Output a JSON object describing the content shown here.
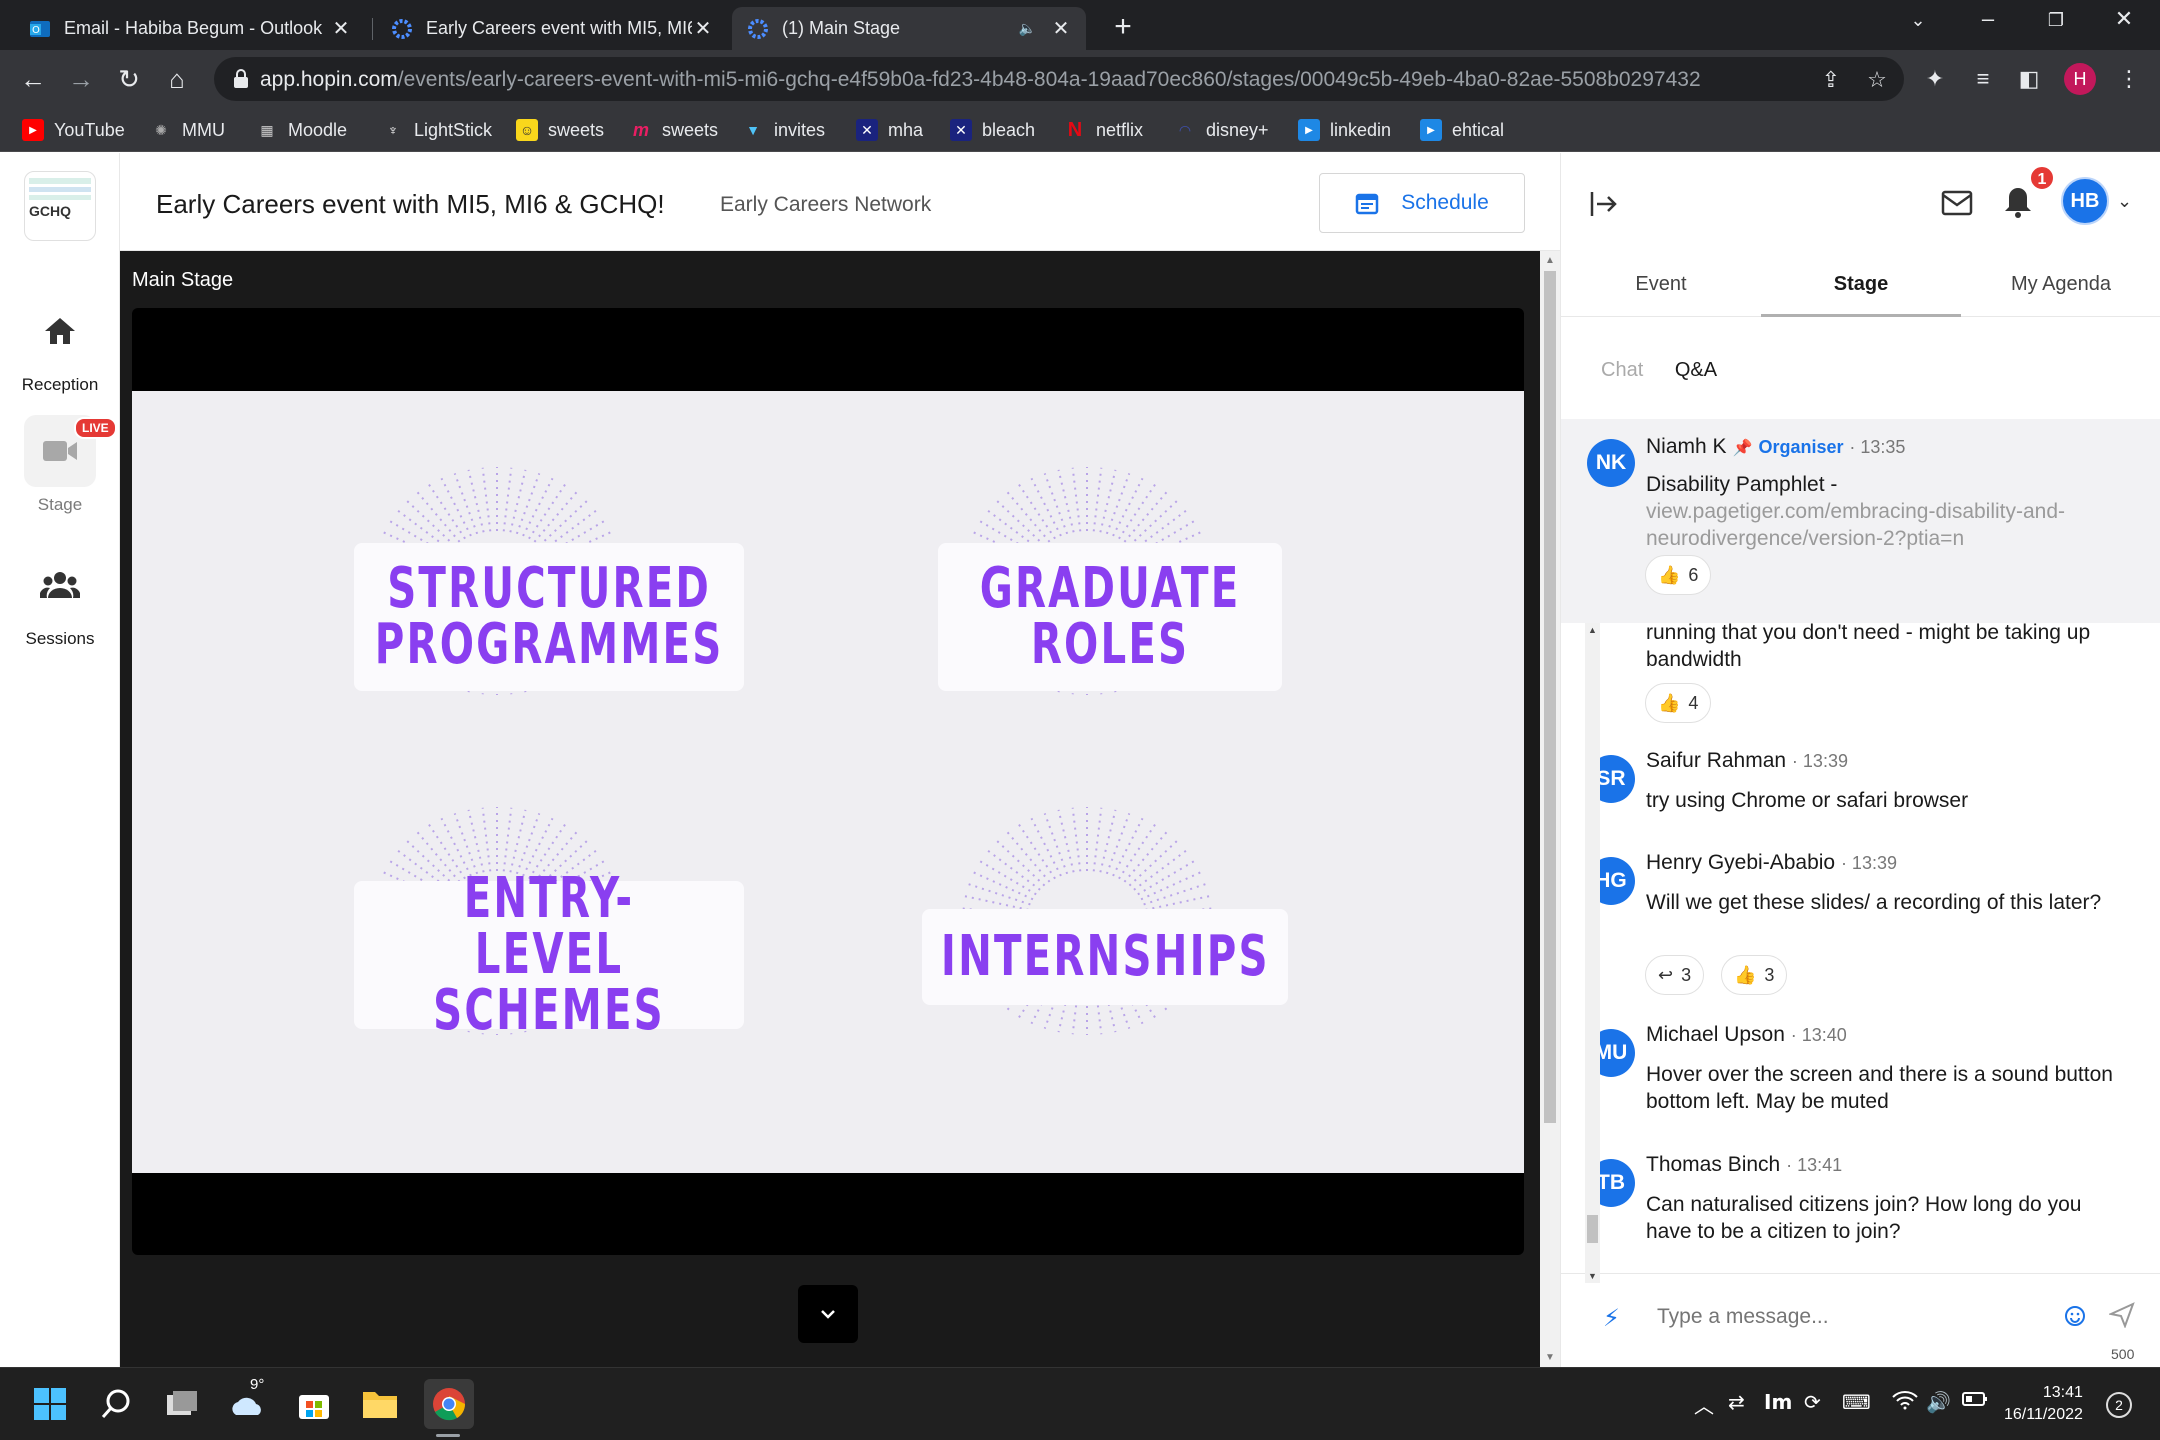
{
  "browser": {
    "tabs": [
      {
        "title": "Email - Habiba Begum - Outlook",
        "icon": "outlook-icon"
      },
      {
        "title": "Early Careers event with MI5, MI6",
        "icon": "hopin-icon"
      },
      {
        "title": "(1) Main Stage",
        "icon": "hopin-icon",
        "audio": true
      }
    ],
    "url_host": "app.hopin.com",
    "url_path": "/events/early-careers-event-with-mi5-mi6-gchq-e4f59b0a-fd23-4b48-804a-19aad70ec860/stages/00049c5b-49eb-4ba0-82ae-5508b0297432",
    "profile_initial": "H",
    "bookmarks": [
      "YouTube",
      "MMU",
      "Moodle",
      "LightStick",
      "sweets",
      "sweets",
      "invites",
      "mha",
      "bleach",
      "netflix",
      "disney+",
      "linkedin",
      "ehtical"
    ]
  },
  "leftnav": {
    "logo_text": "GCHQ",
    "items": [
      {
        "label": "Reception",
        "icon": "home-icon"
      },
      {
        "label": "Stage",
        "icon": "video-camera-icon",
        "badge": "LIVE"
      },
      {
        "label": "Sessions",
        "icon": "people-icon"
      }
    ]
  },
  "header": {
    "title": "Early Careers event with MI5, MI6 & GCHQ!",
    "organizer": "Early Careers Network",
    "schedule_label": "Schedule"
  },
  "stage": {
    "label": "Main Stage",
    "slide": {
      "cards": [
        {
          "line1": "STRUCTURED",
          "line2": "PROGRAMMES"
        },
        {
          "line1": "GRADUATE",
          "line2": "ROLES"
        },
        {
          "line1": "ENTRY-LEVEL",
          "line2": "SCHEMES"
        },
        {
          "line1": "INTERNSHIPS",
          "line2": ""
        }
      ]
    }
  },
  "panel": {
    "notification_count": "1",
    "user_initials": "HB",
    "tabs": [
      "Event",
      "Stage",
      "My Agenda"
    ],
    "active_tab": "Stage",
    "subtabs": {
      "chat": "Chat",
      "qa": "Q&A"
    },
    "pinned": {
      "initials": "NK",
      "name": "Niamh K",
      "role": "Organiser",
      "time": "· 13:35",
      "text": "Disability Pamphlet -",
      "link": "view.pagetiger.com/embracing-disability-and-neurodivergence/version-2?ptia=n",
      "likes": "6"
    },
    "messages": [
      {
        "initials": "",
        "name": "",
        "time": "",
        "text": "running that you don't need - might be taking up bandwidth",
        "likes": "4"
      },
      {
        "initials": "SR",
        "name": "Saifur Rahman",
        "time": "· 13:39",
        "text": "try using Chrome or safari browser"
      },
      {
        "initials": "HG",
        "name": "Henry Gyebi-Ababio",
        "time": "· 13:39",
        "text": "Will we get these slides/ a recording of this later?",
        "replies": "3",
        "likes": "3"
      },
      {
        "initials": "MU",
        "name": "Michael Upson",
        "time": "· 13:40",
        "text": "Hover over the screen and there is a sound button bottom left. May be muted"
      },
      {
        "initials": "TB",
        "name": "Thomas Binch",
        "time": "· 13:41",
        "text": "Can naturalised citizens join? How long do you have to be a citizen to join?"
      }
    ],
    "composer": {
      "placeholder": "Type a message...",
      "char_limit": "500"
    }
  },
  "taskbar": {
    "weather": "9°",
    "time": "13:41",
    "date": "16/11/2022",
    "notifications": "2"
  }
}
